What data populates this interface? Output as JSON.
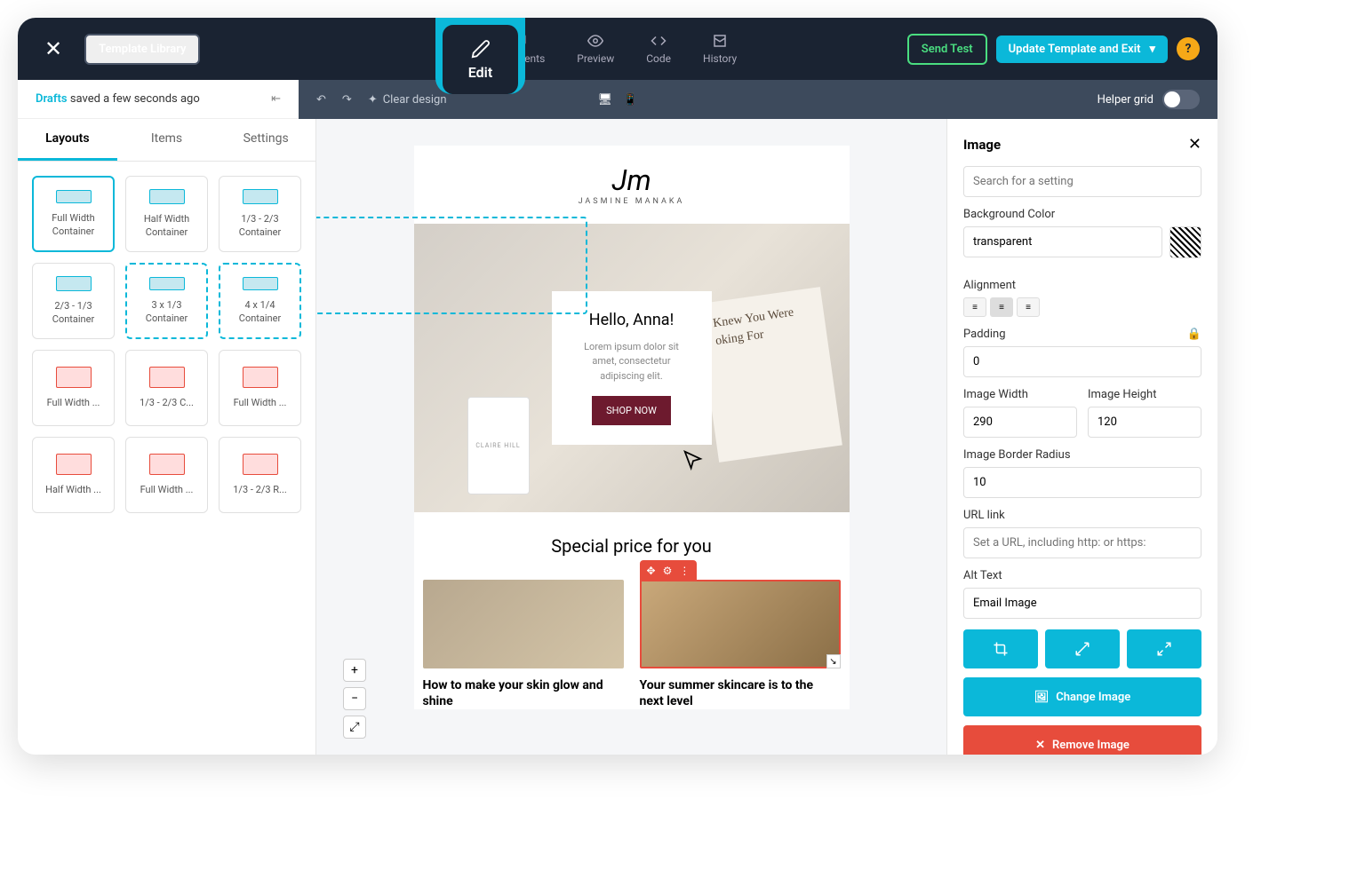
{
  "header": {
    "template_library": "Template Library",
    "edit": "Edit",
    "comments": "Comments",
    "preview": "Preview",
    "code": "Code",
    "history": "History",
    "send_test": "Send Test",
    "update_exit": "Update Template and Exit"
  },
  "subbar": {
    "drafts_label": "Drafts",
    "saved_text": " saved a few seconds ago",
    "clear_design": "Clear design",
    "helper_grid": "Helper grid"
  },
  "sidebar": {
    "tabs": {
      "layouts": "Layouts",
      "items": "Items",
      "settings": "Settings"
    },
    "layouts": [
      {
        "label": "Full Width Container",
        "active": true,
        "color": "t"
      },
      {
        "label": "Half Width Container",
        "color": "t"
      },
      {
        "label": "1/3 - 2/3 Container",
        "color": "t"
      },
      {
        "label": "2/3 - 1/3 Container",
        "color": "t"
      },
      {
        "label": "3 x 1/3 Container",
        "dashed": true,
        "color": "t"
      },
      {
        "label": "4 x 1/4 Container",
        "dashed": true,
        "color": "t"
      },
      {
        "label": "Full Width ...",
        "color": "r"
      },
      {
        "label": "1/3 - 2/3 C...",
        "color": "r"
      },
      {
        "label": "Full Width ...",
        "color": "r"
      },
      {
        "label": "Half Width ...",
        "color": "r"
      },
      {
        "label": "Full Width ...",
        "color": "r"
      },
      {
        "label": "1/3 - 2/3 R...",
        "color": "r"
      }
    ]
  },
  "email": {
    "brand_script": "Jm",
    "brand_sub": "JASMINE MANAKA",
    "hero_book": "Knew You Were oking For",
    "bottle_label": "CLAIRE HILL",
    "hero_title": "Hello, Anna!",
    "hero_text": "Lorem ipsum dolor sit amet, consectetur adipiscing elit.",
    "shop_now": "SHOP NOW",
    "section_title": "Special price for you",
    "product1_title": "How to make your skin glow and shine",
    "product2_title": "Your summer skincare is to the next level"
  },
  "props": {
    "panel_title": "Image",
    "search_placeholder": "Search for a setting",
    "bg_color_label": "Background Color",
    "bg_color_value": "transparent",
    "alignment_label": "Alignment",
    "padding_label": "Padding",
    "padding_value": "0",
    "width_label": "Image Width",
    "width_value": "290",
    "height_label": "Image Height",
    "height_value": "120",
    "radius_label": "Image Border Radius",
    "radius_value": "10",
    "url_label": "URL link",
    "url_placeholder": "Set a URL, including http: or https:",
    "alt_label": "Alt Text",
    "alt_value": "Email Image",
    "change_image": "Change Image",
    "remove_image": "Remove Image"
  }
}
